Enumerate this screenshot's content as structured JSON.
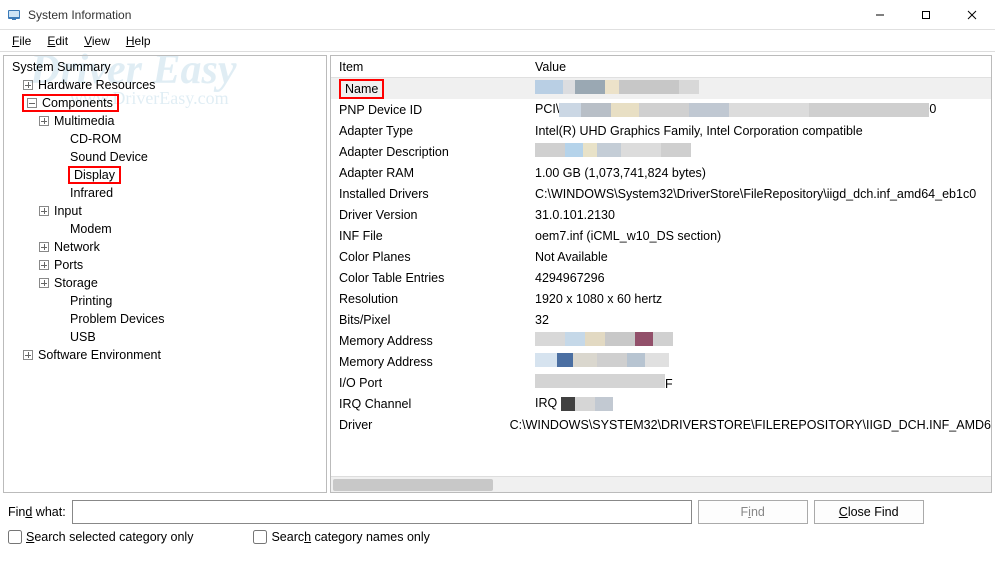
{
  "window": {
    "title": "System Information"
  },
  "menu": {
    "file": "File",
    "edit": "Edit",
    "view": "View",
    "help": "Help"
  },
  "tree": {
    "summary": "System Summary",
    "hardware": "Hardware Resources",
    "components": "Components",
    "multimedia": "Multimedia",
    "cdrom": "CD-ROM",
    "sound": "Sound Device",
    "display": "Display",
    "infrared": "Infrared",
    "input": "Input",
    "modem": "Modem",
    "network": "Network",
    "ports": "Ports",
    "storage": "Storage",
    "printing": "Printing",
    "problem": "Problem Devices",
    "usb": "USB",
    "software": "Software Environment"
  },
  "columns": {
    "item": "Item",
    "value": "Value"
  },
  "rows": {
    "name": {
      "label": "Name",
      "value": ""
    },
    "pnp": {
      "label": "PNP Device ID",
      "value_prefix": "PCI\\",
      "value_suffix": "0"
    },
    "adaptertype": {
      "label": "Adapter Type",
      "value": "Intel(R) UHD Graphics Family, Intel Corporation compatible"
    },
    "adapterdesc": {
      "label": "Adapter Description",
      "value": ""
    },
    "adapterram": {
      "label": "Adapter RAM",
      "value": "1.00 GB (1,073,741,824 bytes)"
    },
    "drivers": {
      "label": "Installed Drivers",
      "value": "C:\\WINDOWS\\System32\\DriverStore\\FileRepository\\iigd_dch.inf_amd64_eb1c0"
    },
    "driverver": {
      "label": "Driver Version",
      "value": "31.0.101.2130"
    },
    "inf": {
      "label": "INF File",
      "value": "oem7.inf (iCML_w10_DS section)"
    },
    "planes": {
      "label": "Color Planes",
      "value": "Not Available"
    },
    "ctentries": {
      "label": "Color Table Entries",
      "value": "4294967296"
    },
    "resolution": {
      "label": "Resolution",
      "value": "1920 x 1080 x 60 hertz"
    },
    "bitspixel": {
      "label": "Bits/Pixel",
      "value": "32"
    },
    "memaddr1": {
      "label": "Memory Address",
      "value": ""
    },
    "memaddr2": {
      "label": "Memory Address",
      "value": ""
    },
    "ioport": {
      "label": "I/O Port",
      "value": ""
    },
    "ioport_suffix": "F",
    "irq": {
      "label": "IRQ Channel",
      "value": "IRQ "
    },
    "driver": {
      "label": "Driver",
      "value": "C:\\WINDOWS\\SYSTEM32\\DRIVERSTORE\\FILEREPOSITORY\\IIGD_DCH.INF_AMD6"
    }
  },
  "find": {
    "label": "Find what:",
    "findbtn": "Find",
    "closebtn": "Close Find",
    "cb1": "Search selected category only",
    "cb2": "Search category names only"
  },
  "watermark": {
    "line1": "Driver Easy",
    "line2": "www.DriverEasy.com"
  }
}
